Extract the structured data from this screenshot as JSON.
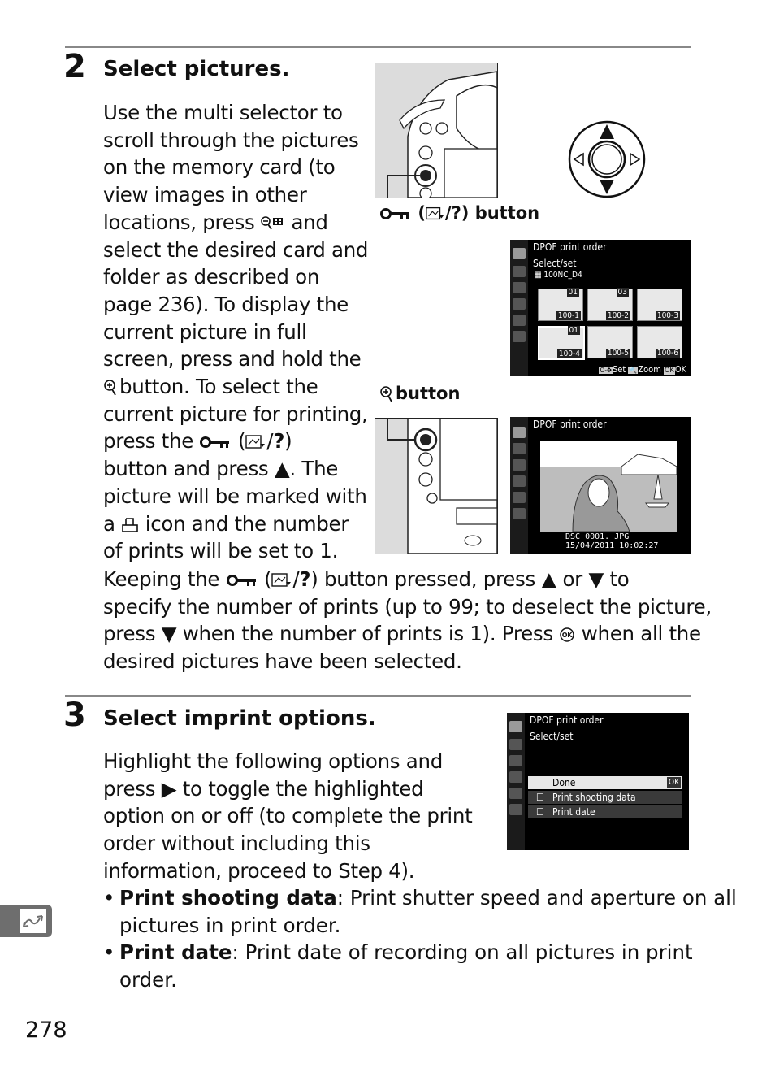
{
  "page_number": "278",
  "side_tab_icon": "retouch-wave-arrows-icon",
  "step2": {
    "number": "2",
    "title": "Select pictures.",
    "body_lines": [
      "Use the multi selector to",
      "scroll through the pictures",
      "on the memory card (to",
      "view images in other",
      "locations, press",
      "and",
      "select the desired card and",
      "folder as described on",
      "page 236).  To display the",
      "current picture in full",
      "screen, press and hold the",
      "button.  To select the",
      "current picture for printing,",
      "press the",
      "(",
      "/",
      "?",
      ")",
      "button and press",
      ".  The",
      "picture will be marked with",
      "a",
      "icon and the number",
      "of prints will be set to 1."
    ],
    "continuation": {
      "l1a": "Keeping the",
      "l1b": "(",
      "l1c": "/",
      "l1d": "?",
      "l1e": ") button pressed, press",
      "l1f": "or",
      "l1g": "to",
      "l2": "specify the number of prints (up to 99; to deselect the picture,",
      "l3a": "press",
      "l3b": "when the number of prints is 1).  Press",
      "l3c": "when all the",
      "l4": "desired pictures have been selected."
    },
    "caption_protect": {
      "q": "?",
      "tail": ") button",
      "open": "(",
      "slash": "/"
    },
    "caption_zoom": "button",
    "screen1": {
      "title": "DPOF print order",
      "subtitle": "Select/set",
      "folder": "100NC_D4",
      "thumbs": [
        {
          "label": "100-1",
          "count": "01"
        },
        {
          "label": "100-2",
          "count": "03"
        },
        {
          "label": "100-3",
          "count": ""
        },
        {
          "label": "100-4",
          "count": "01"
        },
        {
          "label": "100-5",
          "count": ""
        },
        {
          "label": "100-6",
          "count": ""
        }
      ],
      "footer": {
        "set": "Set",
        "zoom": "Zoom",
        "ok": "OK",
        "ok_badge": "OK"
      }
    },
    "screen2": {
      "title": "DPOF print order",
      "filename": "DSC_0001. JPG",
      "datetime": "15/04/2011  10:02:27"
    }
  },
  "step3": {
    "number": "3",
    "title": "Select imprint options.",
    "body_lines": [
      "Highlight the following options and",
      "press",
      "to toggle the highlighted",
      "option on or off (to complete the print",
      "order without including this",
      "information, proceed to Step 4)."
    ],
    "bullets": [
      {
        "term": "Print shooting data",
        "desc_1": ": Print shutter speed and aperture on all",
        "desc_2": "pictures in print order."
      },
      {
        "term": "Print date",
        "desc_1": ": Print date of recording on all pictures in print",
        "desc_2": "order."
      }
    ],
    "screen": {
      "title": "DPOF print order",
      "subtitle": "Select/set",
      "items": [
        {
          "label": "Done",
          "badge": "OK",
          "checked": false,
          "highlighted": true
        },
        {
          "label": "Print shooting data",
          "checked": false,
          "highlighted": false
        },
        {
          "label": "Print date",
          "checked": false,
          "highlighted": false
        }
      ]
    }
  }
}
